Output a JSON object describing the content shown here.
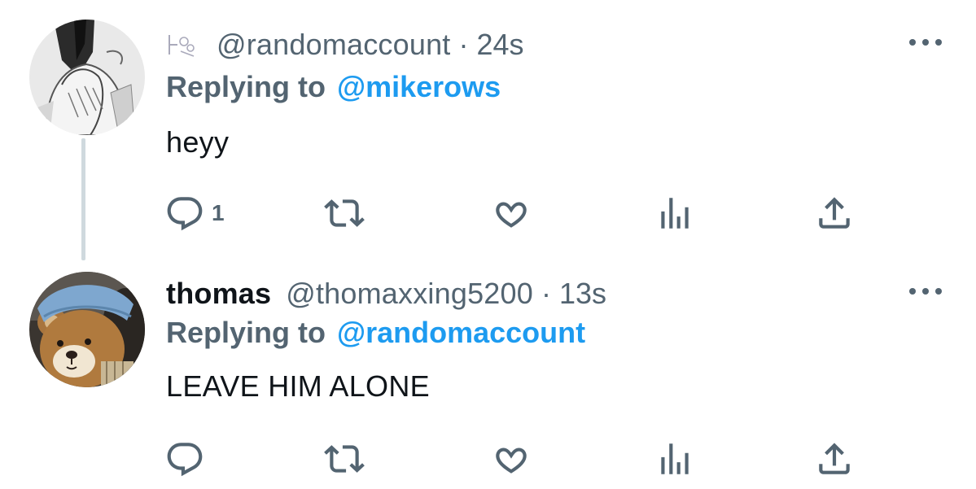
{
  "colors": {
    "text_primary": "#0f1419",
    "text_secondary": "#536471",
    "link": "#1d9bf0",
    "thread_line": "#cfd9de",
    "background": "#ffffff"
  },
  "tweets": [
    {
      "display_name": "",
      "handle": "@randomaccount",
      "separator": "·",
      "time": "24s",
      "reply_prefix": "Replying to",
      "reply_to": "@mikerows",
      "text": "heyy",
      "avatar": "manga-sketch-avatar",
      "actions": {
        "reply_icon": "reply-icon",
        "reply_count": "1",
        "retweet_icon": "retweet-icon",
        "like_icon": "heart-icon",
        "views_icon": "views-icon",
        "share_icon": "share-icon"
      },
      "more_icon": "more-dots-icon"
    },
    {
      "display_name": "thomas",
      "handle": "@thomaxxing5200",
      "separator": "·",
      "time": "13s",
      "reply_prefix": "Replying to",
      "reply_to": "@randomaccount",
      "text": "LEAVE HIM ALONE",
      "avatar": "teddy-bear-avatar",
      "actions": {
        "reply_icon": "reply-icon",
        "reply_count": "",
        "retweet_icon": "retweet-icon",
        "like_icon": "heart-icon",
        "views_icon": "views-icon",
        "share_icon": "share-icon"
      },
      "more_icon": "more-dots-icon"
    }
  ]
}
